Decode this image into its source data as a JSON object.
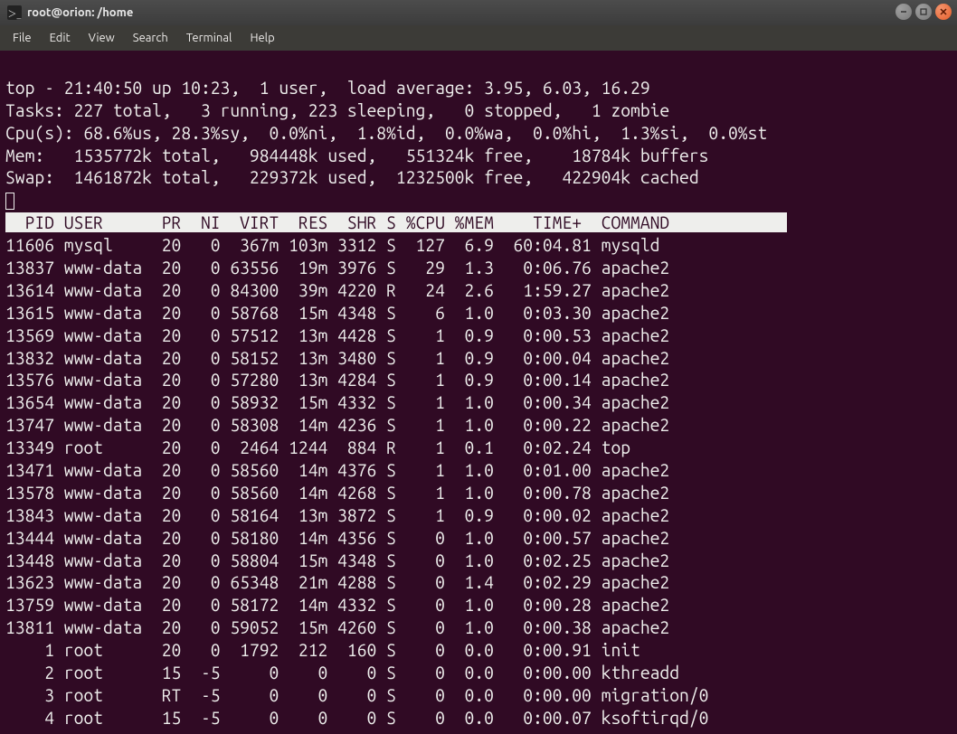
{
  "window": {
    "title": "root@orion: /home"
  },
  "menu": {
    "file": "File",
    "edit": "Edit",
    "view": "View",
    "search": "Search",
    "terminal": "Terminal",
    "help": "Help"
  },
  "top": {
    "line1": "top - 21:40:50 up 10:23,  1 user,  load average: 3.95, 6.03, 16.29",
    "line2": "Tasks: 227 total,   3 running, 223 sleeping,   0 stopped,   1 zombie",
    "line3": "Cpu(s): 68.6%us, 28.3%sy,  0.0%ni,  1.8%id,  0.0%wa,  0.0%hi,  1.3%si,  0.0%st",
    "line4": "Mem:   1535772k total,   984448k used,   551324k free,    18784k buffers",
    "line5": "Swap:  1461872k total,   229372k used,  1232500k free,   422904k cached",
    "header": "  PID USER      PR  NI  VIRT  RES  SHR S %CPU %MEM    TIME+  COMMAND            ",
    "rows": [
      {
        "pid": "11606",
        "user": "mysql",
        "pr": "20",
        "ni": "0",
        "virt": "367m",
        "res": "103m",
        "shr": "3312",
        "s": "S",
        "cpu": "127",
        "mem": "6.9",
        "time": "60:04.81",
        "cmd": "mysqld"
      },
      {
        "pid": "13837",
        "user": "www-data",
        "pr": "20",
        "ni": "0",
        "virt": "63556",
        "res": "19m",
        "shr": "3976",
        "s": "S",
        "cpu": "29",
        "mem": "1.3",
        "time": "0:06.76",
        "cmd": "apache2"
      },
      {
        "pid": "13614",
        "user": "www-data",
        "pr": "20",
        "ni": "0",
        "virt": "84300",
        "res": "39m",
        "shr": "4220",
        "s": "R",
        "cpu": "24",
        "mem": "2.6",
        "time": "1:59.27",
        "cmd": "apache2"
      },
      {
        "pid": "13615",
        "user": "www-data",
        "pr": "20",
        "ni": "0",
        "virt": "58768",
        "res": "15m",
        "shr": "4348",
        "s": "S",
        "cpu": "6",
        "mem": "1.0",
        "time": "0:03.30",
        "cmd": "apache2"
      },
      {
        "pid": "13569",
        "user": "www-data",
        "pr": "20",
        "ni": "0",
        "virt": "57512",
        "res": "13m",
        "shr": "4428",
        "s": "S",
        "cpu": "1",
        "mem": "0.9",
        "time": "0:00.53",
        "cmd": "apache2"
      },
      {
        "pid": "13832",
        "user": "www-data",
        "pr": "20",
        "ni": "0",
        "virt": "58152",
        "res": "13m",
        "shr": "3480",
        "s": "S",
        "cpu": "1",
        "mem": "0.9",
        "time": "0:00.04",
        "cmd": "apache2"
      },
      {
        "pid": "13576",
        "user": "www-data",
        "pr": "20",
        "ni": "0",
        "virt": "57280",
        "res": "13m",
        "shr": "4284",
        "s": "S",
        "cpu": "1",
        "mem": "0.9",
        "time": "0:00.14",
        "cmd": "apache2"
      },
      {
        "pid": "13654",
        "user": "www-data",
        "pr": "20",
        "ni": "0",
        "virt": "58932",
        "res": "15m",
        "shr": "4332",
        "s": "S",
        "cpu": "1",
        "mem": "1.0",
        "time": "0:00.34",
        "cmd": "apache2"
      },
      {
        "pid": "13747",
        "user": "www-data",
        "pr": "20",
        "ni": "0",
        "virt": "58308",
        "res": "14m",
        "shr": "4236",
        "s": "S",
        "cpu": "1",
        "mem": "1.0",
        "time": "0:00.22",
        "cmd": "apache2"
      },
      {
        "pid": "13349",
        "user": "root",
        "pr": "20",
        "ni": "0",
        "virt": "2464",
        "res": "1244",
        "shr": "884",
        "s": "R",
        "cpu": "1",
        "mem": "0.1",
        "time": "0:02.24",
        "cmd": "top"
      },
      {
        "pid": "13471",
        "user": "www-data",
        "pr": "20",
        "ni": "0",
        "virt": "58560",
        "res": "14m",
        "shr": "4376",
        "s": "S",
        "cpu": "1",
        "mem": "1.0",
        "time": "0:01.00",
        "cmd": "apache2"
      },
      {
        "pid": "13578",
        "user": "www-data",
        "pr": "20",
        "ni": "0",
        "virt": "58560",
        "res": "14m",
        "shr": "4268",
        "s": "S",
        "cpu": "1",
        "mem": "1.0",
        "time": "0:00.78",
        "cmd": "apache2"
      },
      {
        "pid": "13843",
        "user": "www-data",
        "pr": "20",
        "ni": "0",
        "virt": "58164",
        "res": "13m",
        "shr": "3872",
        "s": "S",
        "cpu": "1",
        "mem": "0.9",
        "time": "0:00.02",
        "cmd": "apache2"
      },
      {
        "pid": "13444",
        "user": "www-data",
        "pr": "20",
        "ni": "0",
        "virt": "58180",
        "res": "14m",
        "shr": "4356",
        "s": "S",
        "cpu": "0",
        "mem": "1.0",
        "time": "0:00.57",
        "cmd": "apache2"
      },
      {
        "pid": "13448",
        "user": "www-data",
        "pr": "20",
        "ni": "0",
        "virt": "58804",
        "res": "15m",
        "shr": "4348",
        "s": "S",
        "cpu": "0",
        "mem": "1.0",
        "time": "0:02.25",
        "cmd": "apache2"
      },
      {
        "pid": "13623",
        "user": "www-data",
        "pr": "20",
        "ni": "0",
        "virt": "65348",
        "res": "21m",
        "shr": "4288",
        "s": "S",
        "cpu": "0",
        "mem": "1.4",
        "time": "0:02.29",
        "cmd": "apache2"
      },
      {
        "pid": "13759",
        "user": "www-data",
        "pr": "20",
        "ni": "0",
        "virt": "58172",
        "res": "14m",
        "shr": "4332",
        "s": "S",
        "cpu": "0",
        "mem": "1.0",
        "time": "0:00.28",
        "cmd": "apache2"
      },
      {
        "pid": "13811",
        "user": "www-data",
        "pr": "20",
        "ni": "0",
        "virt": "59052",
        "res": "15m",
        "shr": "4260",
        "s": "S",
        "cpu": "0",
        "mem": "1.0",
        "time": "0:00.38",
        "cmd": "apache2"
      },
      {
        "pid": "1",
        "user": "root",
        "pr": "20",
        "ni": "0",
        "virt": "1792",
        "res": "212",
        "shr": "160",
        "s": "S",
        "cpu": "0",
        "mem": "0.0",
        "time": "0:00.91",
        "cmd": "init"
      },
      {
        "pid": "2",
        "user": "root",
        "pr": "15",
        "ni": "-5",
        "virt": "0",
        "res": "0",
        "shr": "0",
        "s": "S",
        "cpu": "0",
        "mem": "0.0",
        "time": "0:00.00",
        "cmd": "kthreadd"
      },
      {
        "pid": "3",
        "user": "root",
        "pr": "RT",
        "ni": "-5",
        "virt": "0",
        "res": "0",
        "shr": "0",
        "s": "S",
        "cpu": "0",
        "mem": "0.0",
        "time": "0:00.00",
        "cmd": "migration/0"
      },
      {
        "pid": "4",
        "user": "root",
        "pr": "15",
        "ni": "-5",
        "virt": "0",
        "res": "0",
        "shr": "0",
        "s": "S",
        "cpu": "0",
        "mem": "0.0",
        "time": "0:00.07",
        "cmd": "ksoftirqd/0"
      }
    ]
  }
}
